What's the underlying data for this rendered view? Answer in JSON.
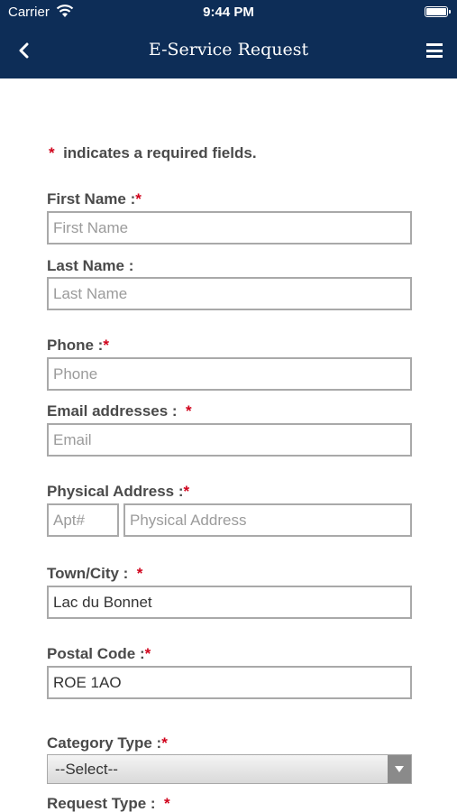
{
  "status": {
    "carrier": "Carrier",
    "time": "9:44 PM"
  },
  "nav": {
    "title": "E-Service Request"
  },
  "note": {
    "star": "*",
    "text": "indicates a required fields."
  },
  "form": {
    "first_name": {
      "label": "First Name :",
      "star": "*",
      "placeholder": "First Name",
      "value": ""
    },
    "last_name": {
      "label": "Last Name :",
      "placeholder": "Last Name",
      "value": ""
    },
    "phone": {
      "label": "Phone :",
      "star": "*",
      "placeholder": "Phone",
      "value": ""
    },
    "email": {
      "label": "Email addresses :",
      "star": "*",
      "placeholder": "Email",
      "value": ""
    },
    "address": {
      "label": "Physical Address :",
      "star": "*",
      "apt_placeholder": "Apt#",
      "placeholder": "Physical Address"
    },
    "town": {
      "label": "Town/City :",
      "star": "*",
      "value": "Lac du Bonnet"
    },
    "postal": {
      "label": "Postal Code :",
      "star": "*",
      "value": "ROE 1AO"
    },
    "category": {
      "label": "Category Type :",
      "star": "*",
      "selected": "--Select--"
    },
    "request": {
      "label": "Request Type :",
      "star": "*"
    }
  }
}
